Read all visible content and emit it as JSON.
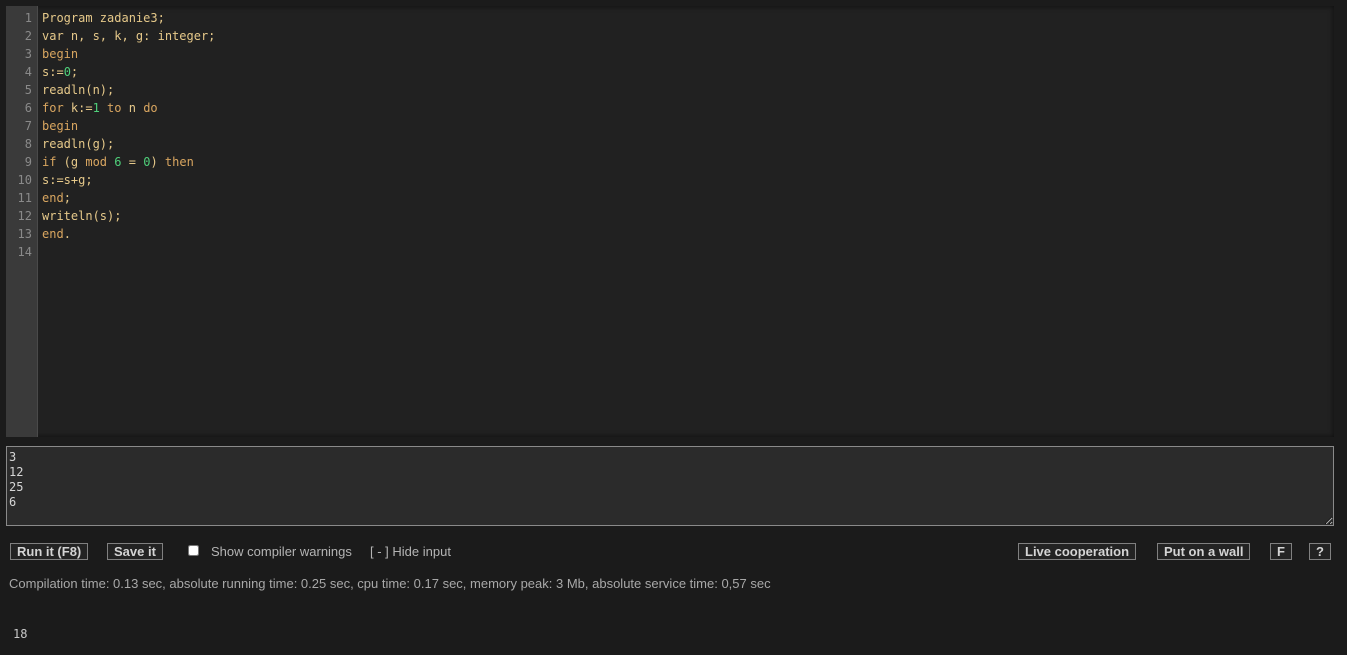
{
  "editor": {
    "line_numbers": [
      "1",
      "2",
      "3",
      "4",
      "5",
      "6",
      "7",
      "8",
      "9",
      "10",
      "11",
      "12",
      "13",
      "14"
    ],
    "lines": [
      [
        {
          "t": "Program zadanie3;",
          "c": "default"
        }
      ],
      [
        {
          "t": "var n, s, k, g: integer;",
          "c": "default"
        }
      ],
      [
        {
          "t": "begin",
          "c": "kw"
        }
      ],
      [
        {
          "t": "s:=",
          "c": "default"
        },
        {
          "t": "0",
          "c": "num"
        },
        {
          "t": ";",
          "c": "default"
        }
      ],
      [
        {
          "t": "readln(n);",
          "c": "default"
        }
      ],
      [
        {
          "t": "for",
          "c": "kw"
        },
        {
          "t": " k:=",
          "c": "default"
        },
        {
          "t": "1",
          "c": "num"
        },
        {
          "t": " to ",
          "c": "kw"
        },
        {
          "t": "n ",
          "c": "default"
        },
        {
          "t": "do",
          "c": "kw"
        }
      ],
      [
        {
          "t": "begin",
          "c": "kw"
        }
      ],
      [
        {
          "t": "readln(g);",
          "c": "default"
        }
      ],
      [
        {
          "t": "if",
          "c": "kw"
        },
        {
          "t": " (g ",
          "c": "default"
        },
        {
          "t": "mod",
          "c": "kw"
        },
        {
          "t": " ",
          "c": "default"
        },
        {
          "t": "6",
          "c": "num"
        },
        {
          "t": " = ",
          "c": "default"
        },
        {
          "t": "0",
          "c": "num"
        },
        {
          "t": ") ",
          "c": "default"
        },
        {
          "t": "then",
          "c": "kw"
        }
      ],
      [
        {
          "t": "s:=s+g;",
          "c": "default"
        }
      ],
      [
        {
          "t": "end",
          "c": "kw"
        },
        {
          "t": ";",
          "c": "default"
        }
      ],
      [
        {
          "t": "writeln(s);",
          "c": "default"
        }
      ],
      [
        {
          "t": "end",
          "c": "kw"
        },
        {
          "t": ".",
          "c": "default"
        }
      ],
      [
        {
          "t": "",
          "c": "default"
        }
      ]
    ]
  },
  "stdin": {
    "value": "3\n12\n25\n6"
  },
  "toolbar": {
    "run_label": "Run it (F8)",
    "save_label": "Save it",
    "warnings_label": "Show compiler warnings",
    "warnings_checked": false,
    "hide_input_label": "[ - ] Hide input",
    "live_coop_label": "Live cooperation",
    "wall_label": "Put on a wall",
    "f_label": "F",
    "help_label": "?"
  },
  "stats": {
    "text": "Compilation time: 0.13 sec, absolute running time: 0.25 sec, cpu time: 0.17 sec, memory peak: 3 Mb, absolute service time: 0,57 sec"
  },
  "output": {
    "text": "18"
  },
  "colors": {
    "background": "#1b1b1b",
    "editor_bg": "#212121",
    "gutter_bg": "#3a3a3a",
    "code_text": "#e6c98a",
    "keyword": "#d9a660",
    "number": "#4fd07a"
  }
}
